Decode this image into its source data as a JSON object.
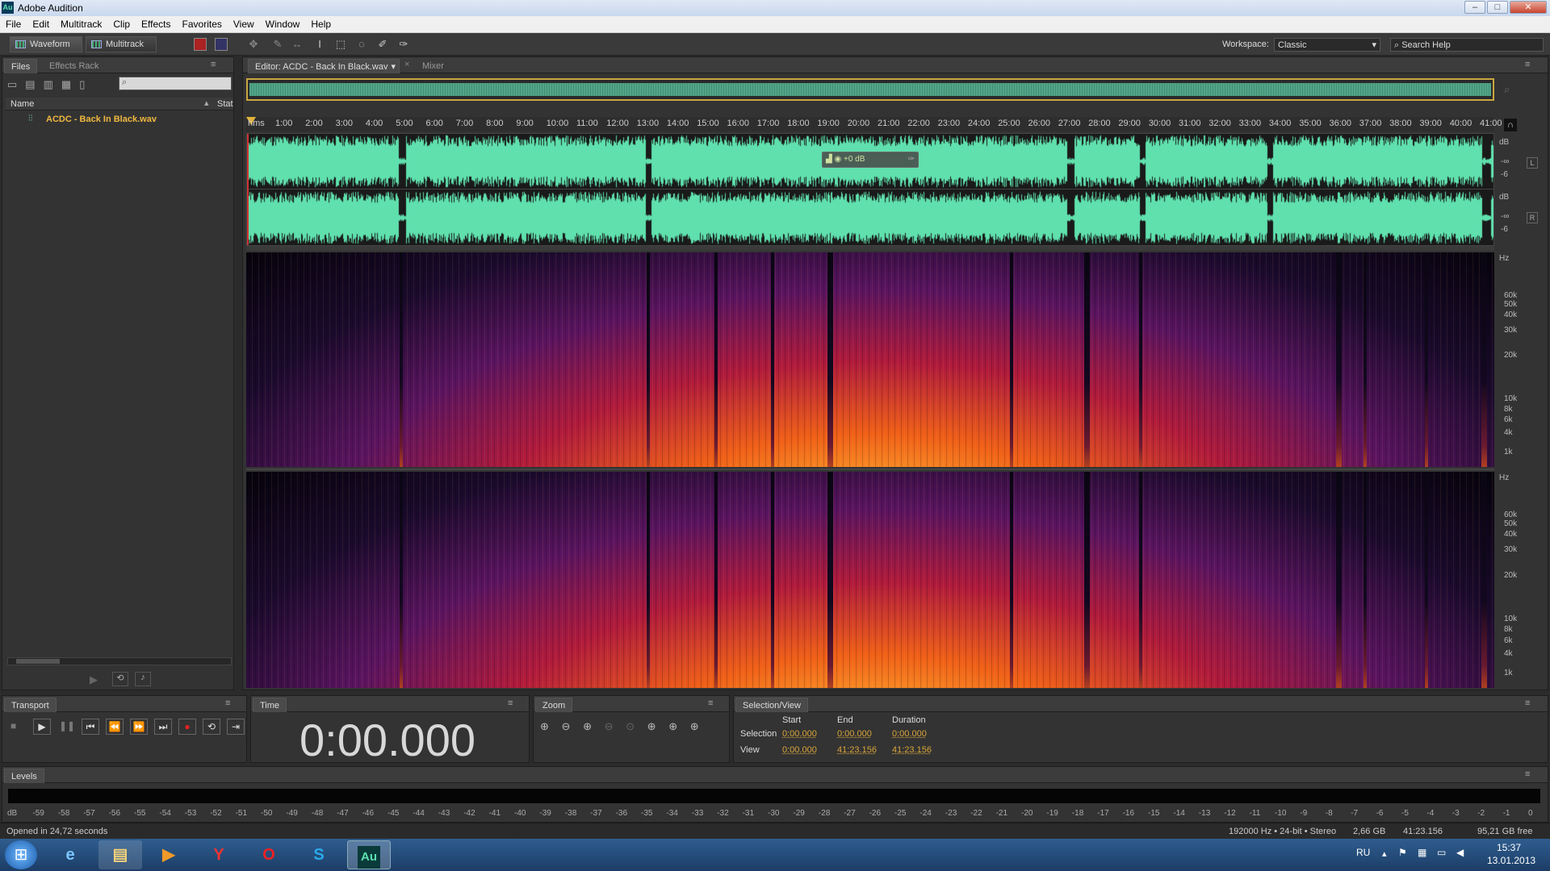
{
  "app": {
    "title": "Adobe Audition",
    "logo": "Au"
  },
  "menu": [
    "File",
    "Edit",
    "Multitrack",
    "Clip",
    "Effects",
    "Favorites",
    "View",
    "Window",
    "Help"
  ],
  "toolbar": {
    "waveform": "Waveform",
    "multitrack": "Multitrack",
    "workspace_label": "Workspace:",
    "workspace_value": "Classic",
    "search_placeholder": "Search Help"
  },
  "files_panel": {
    "tabs": [
      "Files",
      "Effects Rack"
    ],
    "col_name": "Name",
    "col_status": "Stat",
    "items": [
      {
        "name": "ACDC - Back In Black.wav"
      }
    ]
  },
  "editor": {
    "tab": "Editor: ACDC - Back In Black.wav",
    "mixer_tab": "Mixer",
    "hud_gain": "+0 dB",
    "ruler_unit": "hms",
    "ticks": [
      "1:00",
      "2:00",
      "3:00",
      "4:00",
      "5:00",
      "6:00",
      "7:00",
      "8:00",
      "9:00",
      "10:00",
      "11:00",
      "12:00",
      "13:00",
      "14:00",
      "15:00",
      "16:00",
      "17:00",
      "18:00",
      "19:00",
      "20:00",
      "21:00",
      "22:00",
      "23:00",
      "24:00",
      "25:00",
      "26:00",
      "27:00",
      "28:00",
      "29:00",
      "30:00",
      "31:00",
      "32:00",
      "33:00",
      "34:00",
      "35:00",
      "36:00",
      "37:00",
      "38:00",
      "39:00",
      "40:00",
      "41:00"
    ],
    "db_label": "dB",
    "db_inf": "-∞",
    "db_six": "-6",
    "chan_left": "L",
    "chan_right": "R",
    "hz_label": "Hz",
    "hz_ticks": [
      "60k",
      "50k",
      "40k",
      "30k",
      "20k",
      "10k",
      "8k",
      "6k",
      "4k",
      "1k"
    ]
  },
  "transport": {
    "title": "Transport"
  },
  "time": {
    "title": "Time",
    "value": "0:00.000"
  },
  "zoom": {
    "title": "Zoom"
  },
  "selection": {
    "title": "Selection/View",
    "col_start": "Start",
    "col_end": "End",
    "col_duration": "Duration",
    "row_selection": "Selection",
    "row_view": "View",
    "sel_start": "0:00.000",
    "sel_end": "0:00.000",
    "sel_duration": "0:00.000",
    "view_start": "0:00.000",
    "view_end": "41:23.156",
    "view_duration": "41:23.156"
  },
  "levels": {
    "title": "Levels",
    "scale": [
      "dB",
      "-59",
      "-58",
      "-57",
      "-56",
      "-55",
      "-54",
      "-53",
      "-52",
      "-51",
      "-50",
      "-49",
      "-48",
      "-47",
      "-46",
      "-45",
      "-44",
      "-43",
      "-42",
      "-41",
      "-40",
      "-39",
      "-38",
      "-37",
      "-36",
      "-35",
      "-34",
      "-33",
      "-32",
      "-31",
      "-30",
      "-29",
      "-28",
      "-27",
      "-26",
      "-25",
      "-24",
      "-23",
      "-22",
      "-21",
      "-20",
      "-19",
      "-18",
      "-17",
      "-16",
      "-15",
      "-14",
      "-13",
      "-12",
      "-11",
      "-10",
      "-9",
      "-8",
      "-7",
      "-6",
      "-5",
      "-4",
      "-3",
      "-2",
      "-1",
      "0"
    ]
  },
  "status": {
    "left": "Opened in 24,72 seconds",
    "format": "192000 Hz • 24-bit • Stereo",
    "size": "2,66 GB",
    "duration": "41:23.156",
    "free": "95,21 GB free"
  },
  "taskbar": {
    "lang": "RU",
    "time": "15:37",
    "date": "13.01.2013",
    "au": "Au"
  }
}
